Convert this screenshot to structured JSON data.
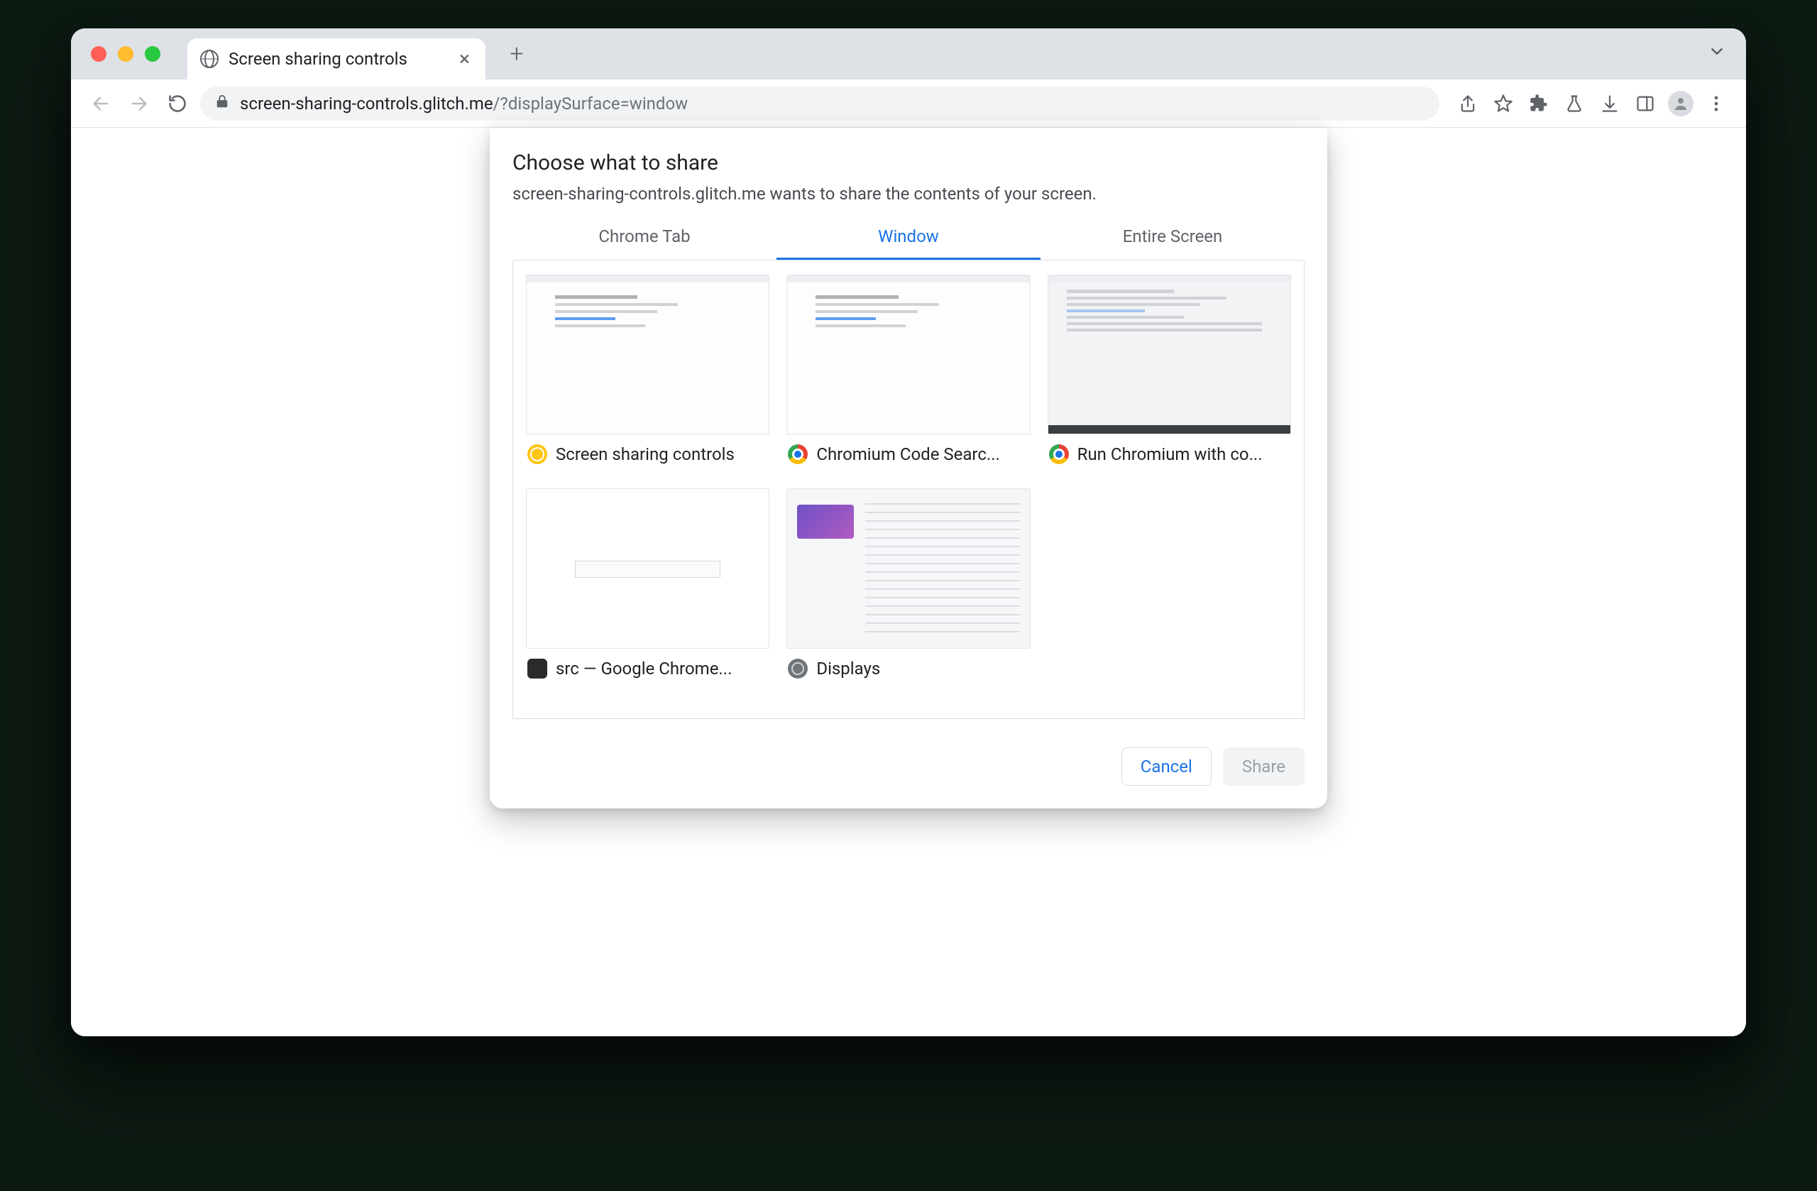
{
  "tab": {
    "title": "Screen sharing controls"
  },
  "url": {
    "host": "screen-sharing-controls.glitch.me",
    "rest": "/?displaySurface=window"
  },
  "dialog": {
    "title": "Choose what to share",
    "subtitle": "screen-sharing-controls.glitch.me wants to share the contents of your screen.",
    "tabs": {
      "chrome_tab": "Chrome Tab",
      "window": "Window",
      "entire_screen": "Entire Screen"
    },
    "windows": [
      {
        "label": "Screen sharing controls",
        "icon": "canary"
      },
      {
        "label": "Chromium Code Searc...",
        "icon": "chrome"
      },
      {
        "label": "Run Chromium with co...",
        "icon": "chrome"
      },
      {
        "label": "src — Google Chrome...",
        "icon": "term"
      },
      {
        "label": "Displays",
        "icon": "sys"
      }
    ],
    "actions": {
      "cancel": "Cancel",
      "share": "Share"
    }
  }
}
